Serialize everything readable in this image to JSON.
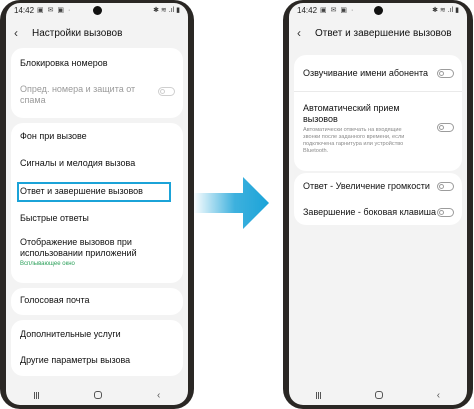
{
  "left": {
    "status": {
      "time": "14:42",
      "icons": "▣ ✉ ▣ ·",
      "right": "✱ ≋ .ıl ▮"
    },
    "header": {
      "title": "Настройки вызовов"
    },
    "items": {
      "block": "Блокировка номеров",
      "spam": "Опред. номера и защита от спама",
      "background": "Фон при вызове",
      "ringtone": "Сигналы и мелодия вызова",
      "answer_end": "Ответ и завершение вызовов",
      "quick_replies": "Быстрые ответы",
      "display_apps": "Отображение вызовов при использовании приложений",
      "display_apps_sub": "Всплывающее окно",
      "voicemail": "Голосовая почта",
      "additional": "Дополнительные услуги",
      "other": "Другие параметры вызова"
    }
  },
  "right": {
    "status": {
      "time": "14:42",
      "icons": "▣ ✉ ▣ ·",
      "right": "✱ ≋ .ıl ▮"
    },
    "header": {
      "title": "Ответ и завершение вызовов"
    },
    "items": {
      "announce": "Озвучивание имени абонента",
      "auto_answer": "Автоматический прием вызовов",
      "auto_answer_desc": "Автоматически отвечать на входящие звонки после заданного времени, если подключена гарнитура или устройство Bluetooth.",
      "volume_up": "Ответ - Увеличение громкости",
      "side_key": "Завершение - боковая клавиша"
    }
  },
  "colors": {
    "highlight": "#1ba3d8",
    "arrow": "#1ba3d8",
    "sub_text": "#2ba05a"
  },
  "icons": {
    "back": "back-arrow-icon",
    "nav_recents": "recents-icon",
    "nav_home": "home-icon",
    "nav_back": "chevron-left-icon"
  }
}
